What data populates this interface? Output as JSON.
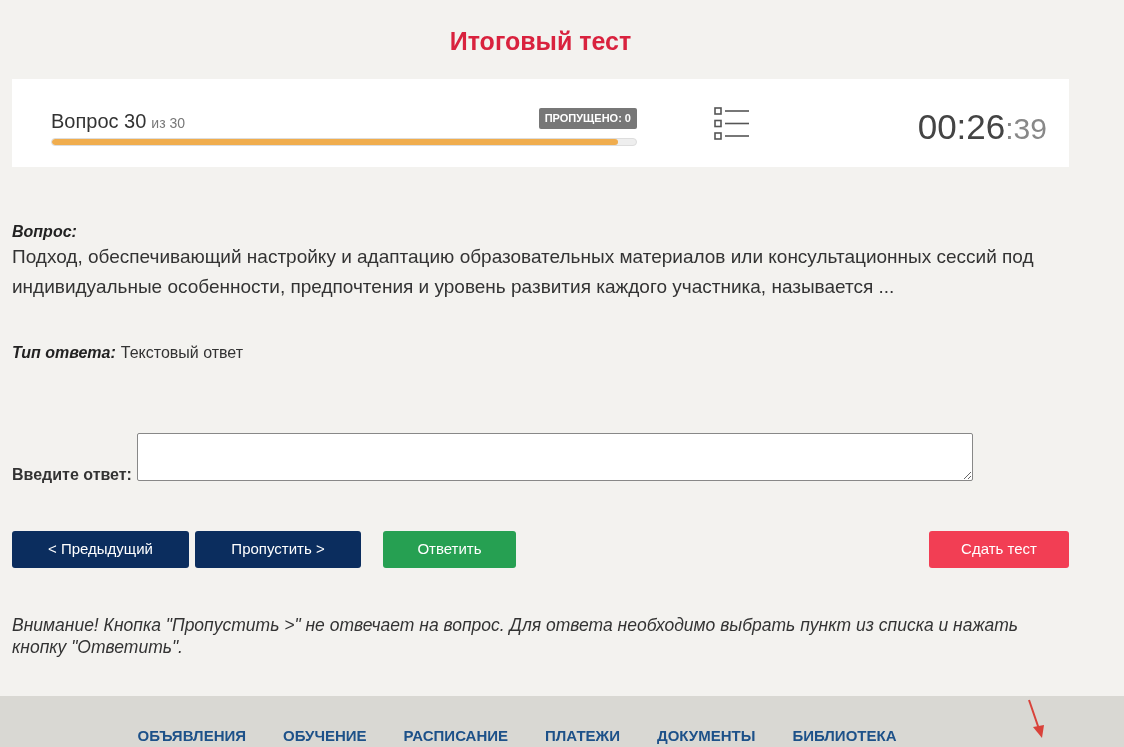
{
  "page_title": "Итоговый тест",
  "header": {
    "question_label": "Вопрос 30",
    "question_total": "из 30",
    "skipped_badge": "ПРОПУЩЕНО: 0",
    "progress": {
      "level": 0.97
    },
    "timer": {
      "main": "00:26",
      "seconds": ":39"
    }
  },
  "question": {
    "label": "Вопрос:",
    "text": "Подход, обеспечивающий настройку и адаптацию образовательных материалов или консультационных сессий под индивидуальные особенности, предпочтения и уровень развития каждого участника, называется ..."
  },
  "answer_type": {
    "label": "Тип ответа:",
    "value": "Текстовый ответ"
  },
  "answer": {
    "label": "Введите ответ:"
  },
  "buttons": [
    {
      "label": "< Предыдущий",
      "kind": "nav"
    },
    {
      "label": "Пропустить >",
      "kind": "nav"
    },
    {
      "label": "Ответить",
      "kind": "answer"
    },
    {
      "label": "Сдать тест",
      "kind": "submit"
    }
  ],
  "notice": "Внимание! Кнопка \"Пропустить >\" не отвечает на вопрос. Для ответа необходимо выбрать пункт из списка и нажать кнопку \"Ответить\".",
  "footer_nav": [
    "ОБЪЯВЛЕНИЯ",
    "ОБУЧЕНИЕ",
    "РАСПИСАНИЕ",
    "ПЛАТЕЖИ",
    "ДОКУМЕНТЫ",
    "БИБЛИОТЕКА"
  ]
}
